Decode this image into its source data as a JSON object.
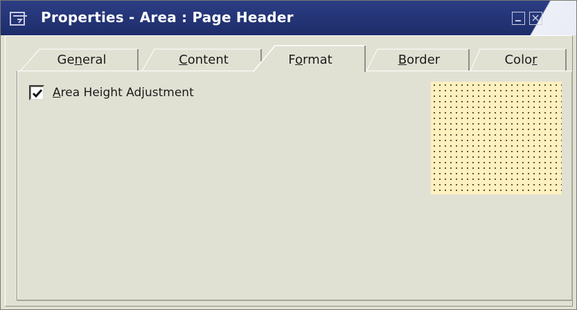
{
  "window": {
    "title": "Properties - Area : Page Header",
    "buttons": [
      {
        "name": "minimize",
        "icon": "minimize-icon"
      },
      {
        "name": "close",
        "icon": "close-icon"
      }
    ]
  },
  "tabs": [
    {
      "label": "General",
      "mnemonic_char": "n",
      "active": false
    },
    {
      "label": "Content",
      "mnemonic_char": "C",
      "active": false
    },
    {
      "label": "Format",
      "mnemonic_char": "o",
      "active": true
    },
    {
      "label": "Border",
      "mnemonic_char": "B",
      "active": false
    },
    {
      "label": "Color",
      "mnemonic_char": "r",
      "active": false
    }
  ],
  "format_tab": {
    "area_height_adjustment": {
      "label": "Area Height Adjustment",
      "mnemonic_char": "A",
      "checked": true
    },
    "preview": {
      "fill_color": "#fff0c0",
      "dot_color": "#5a4a28"
    }
  },
  "colors": {
    "titlebar": "#233374",
    "title_text": "#ffffff",
    "dialog_bg": "#e1e1d3"
  }
}
